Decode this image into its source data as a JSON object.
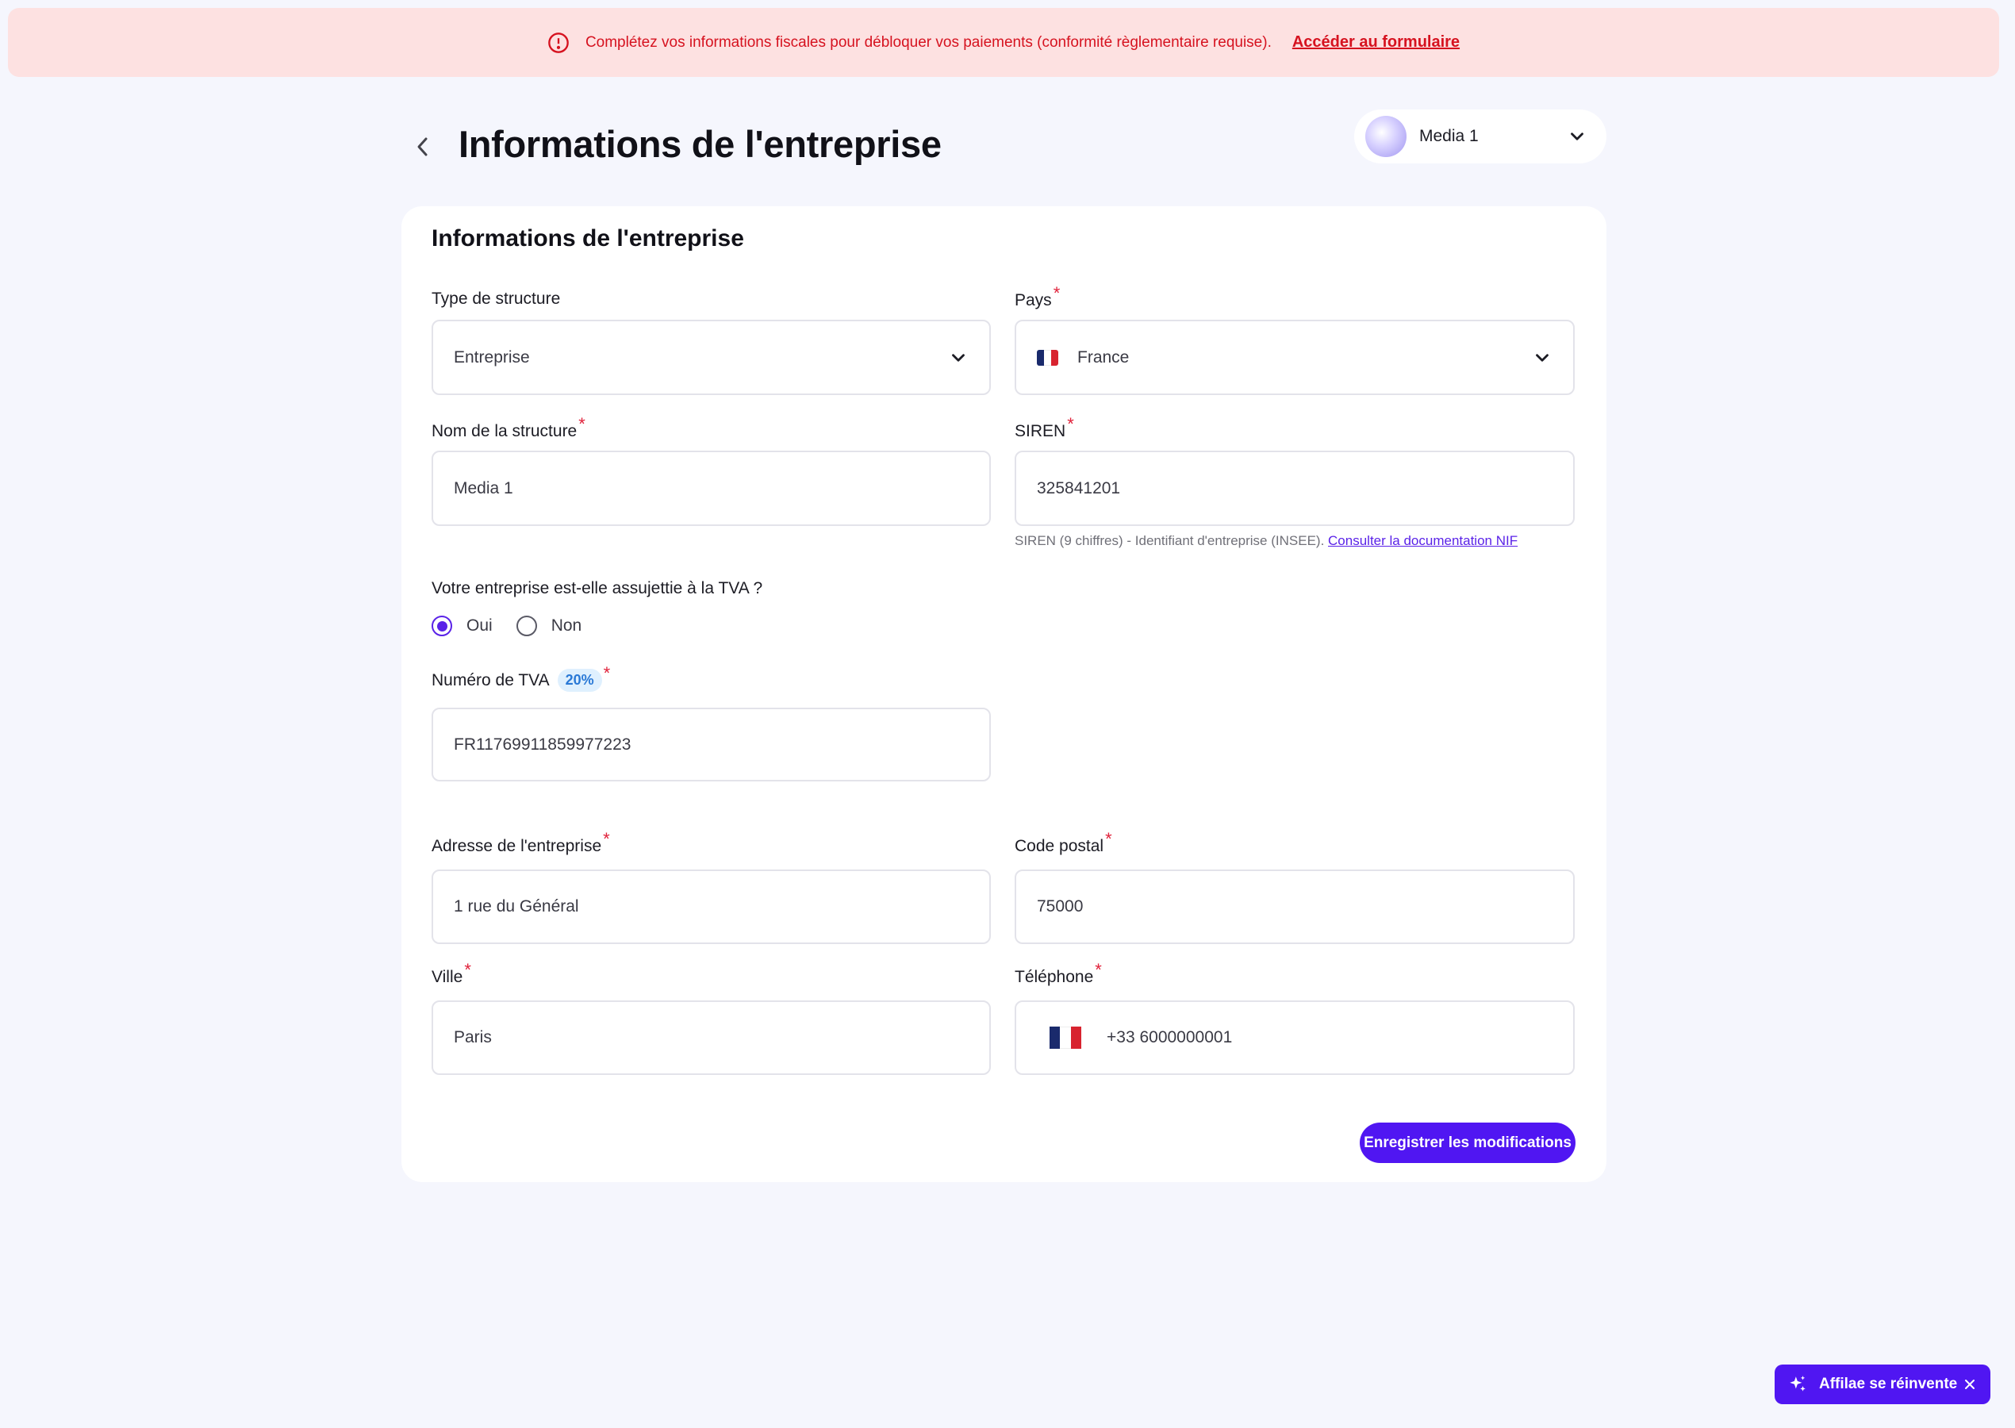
{
  "alert": {
    "message": "Complétez vos informations fiscales pour débloquer vos paiements (conformité règlementaire requise).",
    "link_label": "Accéder au formulaire"
  },
  "header": {
    "title": "Informations de l'entreprise",
    "account_name": "Media 1"
  },
  "card": {
    "title": "Informations de l'entreprise"
  },
  "form": {
    "structure_type": {
      "label": "Type de structure",
      "value": "Entreprise"
    },
    "country": {
      "label": "Pays",
      "required": "*",
      "value": "France"
    },
    "structure_name": {
      "label": "Nom de la structure",
      "required": "*",
      "value": "Media 1"
    },
    "siren": {
      "label": "SIREN",
      "required": "*",
      "value": "325841201",
      "hint": "SIREN (9 chiffres) - Identifiant d'entreprise (INSEE).",
      "hint_link": "Consulter la documentation NIF"
    },
    "vat_question": {
      "label": "Votre entreprise est-elle assujettie à la TVA ?",
      "options": [
        "Oui",
        "Non"
      ],
      "selected": "Oui"
    },
    "vat_number": {
      "label": "Numéro de TVA",
      "badge": "20%",
      "required": "*",
      "value": "FR11769911859977223"
    },
    "address": {
      "label": "Adresse de l'entreprise",
      "required": "*",
      "value": "1 rue du Général"
    },
    "postal_code": {
      "label": "Code postal",
      "required": "*",
      "value": "75000"
    },
    "city": {
      "label": "Ville",
      "required": "*",
      "value": "Paris"
    },
    "phone": {
      "label": "Téléphone",
      "required": "*",
      "value": "+33 6000000001"
    },
    "save_label": "Enregistrer les modifications"
  },
  "promo": {
    "label": "Affilae se réinvente"
  },
  "colors": {
    "accent": "#5016f2",
    "alert_bg": "#fde1e1",
    "alert_text": "#d6121f",
    "required": "#e0213a",
    "badge_bg": "#dff0fe",
    "page_bg": "#f5f6fd"
  },
  "icons": {
    "alert": "info-circle-icon",
    "back": "chevron-left-icon",
    "dropdown": "chevron-down-icon",
    "flag": "flag-france-icon",
    "promo": "sparkle-icon",
    "close": "close-icon"
  }
}
